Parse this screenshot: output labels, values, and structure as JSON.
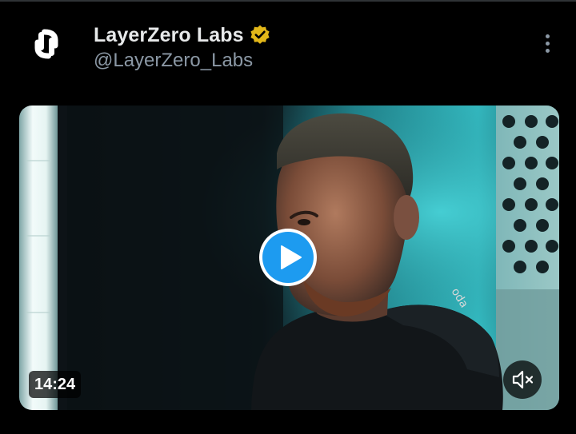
{
  "account": {
    "display_name": "LayerZero Labs",
    "handle": "@LayerZero_Labs",
    "verified_badge": "gold-verified-badge-icon",
    "avatar_icon": "layerzero-logo-icon"
  },
  "header": {
    "more_icon": "more-vertical-icon"
  },
  "video": {
    "duration": "14:24",
    "play_icon": "play-icon",
    "volume_icon": "volume-muted-icon",
    "hoodie_print": "oda"
  },
  "colors": {
    "background": "#000000",
    "name_text": "#e7e9ea",
    "handle_text": "#8b98a5",
    "verified_gold": "#e2b719",
    "play_blue": "#1d9bf0",
    "teal_glow": "#2fb3bb"
  }
}
